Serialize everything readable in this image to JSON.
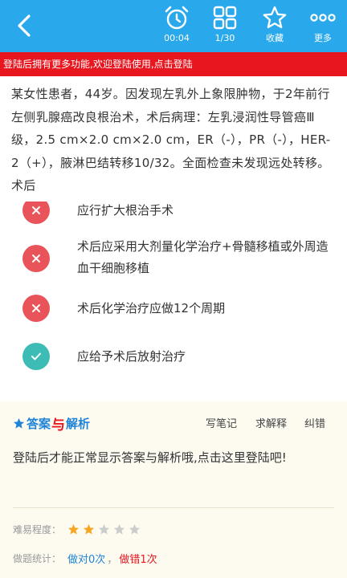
{
  "toolbar": {
    "timer_value": "00:04",
    "progress_value": "1/30",
    "favorite_label": "收藏",
    "more_label": "更多"
  },
  "login_banner": "登陆后拥有更多功能,欢迎登陆使用,点击登陆",
  "question": {
    "text": "某女性患者，44岁。因发现左乳外上象限肿物，于2年前行左侧乳腺癌改良根治术，术后病理：左乳浸润性导管癌Ⅲ级，2.5 cm×2.0 cm×2.0 cm，ER（-），PR（-），HER-2（+），腋淋巴结转移10/32。全面检查未发现远处转移。术后"
  },
  "options": [
    {
      "text": "应行扩大根治手术",
      "state": "wrong"
    },
    {
      "text": "术后应采用大剂量化学治疗+骨髓移植或外周造血干细胞移植",
      "state": "wrong"
    },
    {
      "text": "术后化学治疗应做12个周期",
      "state": "wrong"
    },
    {
      "text": "应给予术后放射治疗",
      "state": "right"
    }
  ],
  "answer": {
    "title_part1": "答案",
    "title_part2": "与",
    "title_part3": "解析",
    "links": [
      "写笔记",
      "求解释",
      "纠错"
    ],
    "message": "登陆后才能正常显示答案与解析哦,点击这里登陆吧!",
    "difficulty_label": "难易程度：",
    "difficulty_stars": 2,
    "difficulty_max": 5,
    "stats_label": "做题统计：",
    "stats_right": "做对0次",
    "stats_sep": "，",
    "stats_wrong": "做错1次"
  },
  "colors": {
    "header": "#29a9ec",
    "banner": "#e8161e",
    "wrong": "#e8545a",
    "right": "#3cbcb5",
    "link_blue": "#1f84d8",
    "star_on": "#f5a623",
    "star_off": "#cccccc"
  },
  "icons": {
    "back": "chevron-left-icon",
    "timer": "alarm-clock-icon",
    "progress": "grid-icon",
    "favorite": "star-outline-icon",
    "more": "dots-icon",
    "wrong": "cross-icon",
    "right": "check-icon",
    "title_star": "star-icon"
  }
}
